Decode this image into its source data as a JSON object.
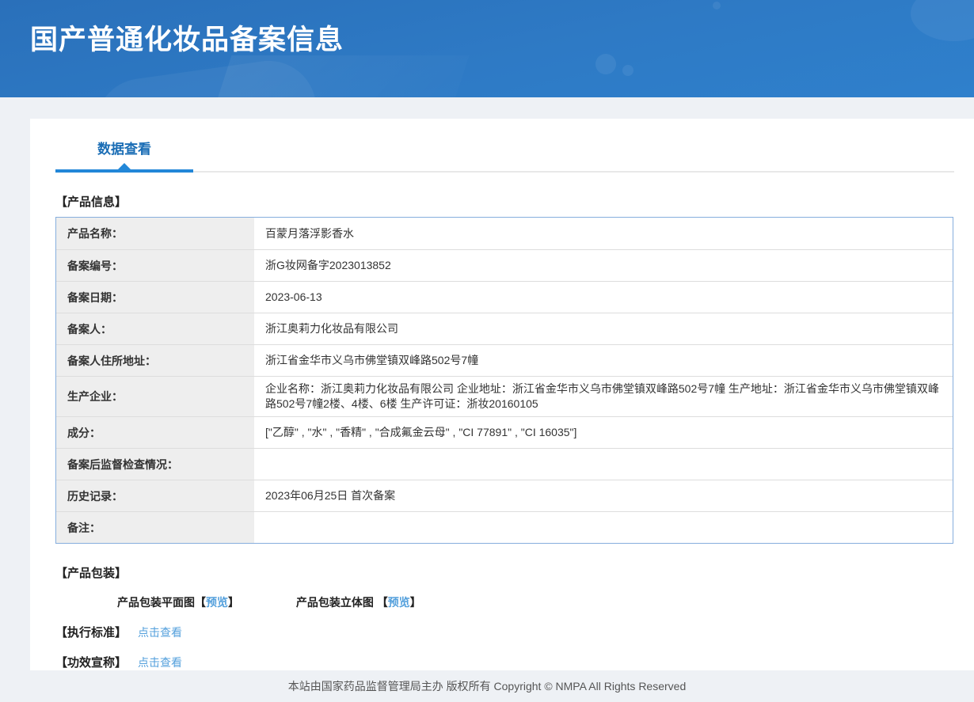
{
  "header": {
    "title": "国产普通化妆品备案信息"
  },
  "tabs": {
    "data_view": "数据查看"
  },
  "product_info": {
    "section_title": "【产品信息】",
    "rows": [
      {
        "label": "产品名称：",
        "value": "百蒙月落浮影香水"
      },
      {
        "label": "备案编号：",
        "value": "浙G妆网备字2023013852"
      },
      {
        "label": "备案日期：",
        "value": "2023-06-13"
      },
      {
        "label": "备案人：",
        "value": "浙江奥莉力化妆品有限公司"
      },
      {
        "label": "备案人住所地址：",
        "value": "浙江省金华市义乌市佛堂镇双峰路502号7幢"
      },
      {
        "label": "生产企业：",
        "value": "企业名称：浙江奥莉力化妆品有限公司 企业地址：浙江省金华市义乌市佛堂镇双峰路502号7幢 生产地址：浙江省金华市义乌市佛堂镇双峰路502号7幢2楼、4楼、6楼 生产许可证：浙妆20160105"
      },
      {
        "label": "成分：",
        "value": "[\"乙醇\" , \"水\" , \"香精\" , \"合成氟金云母\" , \"CI 77891\" , \"CI 16035\"]"
      },
      {
        "label": "备案后监督检查情况：",
        "value": ""
      },
      {
        "label": "历史记录：",
        "value": "2023年06月25日 首次备案"
      },
      {
        "label": "备注：",
        "value": ""
      }
    ]
  },
  "packaging": {
    "section_title": "【产品包装】",
    "items": [
      {
        "label": "产品包装平面图",
        "bracket_open": "【",
        "link": "预览",
        "bracket_close": "】"
      },
      {
        "label": "产品包装立体图 ",
        "bracket_open": "【",
        "link": "预览",
        "bracket_close": "】"
      }
    ]
  },
  "standard": {
    "title": "【执行标准】",
    "link": "点击查看"
  },
  "efficacy": {
    "title": "【功效宣称】",
    "link": "点击查看"
  },
  "footer": {
    "text": "本站由国家药品监督管理局主办 版权所有 Copyright © NMPA All Rights Reserved"
  },
  "colors": {
    "banner_top": "#2a70ba",
    "banner_bottom": "#2f80cc",
    "accent_blue": "#2287d8",
    "tab_text": "#1a6db5",
    "link_blue": "#54a0dc",
    "table_border": "#86aedd",
    "label_bg": "#eeeeee",
    "page_bg": "#eef1f5"
  }
}
